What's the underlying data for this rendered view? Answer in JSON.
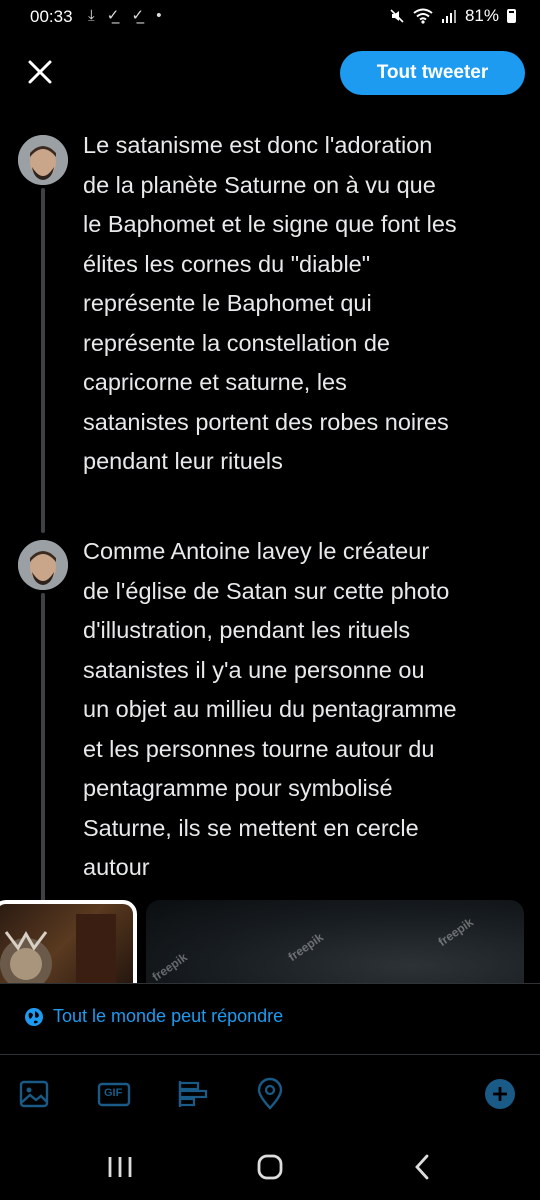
{
  "status_bar": {
    "time": "00:33",
    "left_icons": "⤓ ✓̲ ✓̲ •",
    "battery": "81%",
    "icons": [
      "download-icon",
      "check-icon",
      "check-icon",
      "dot-icon",
      "mute-icon",
      "wifi-icon",
      "signal-icon",
      "battery-icon"
    ]
  },
  "header": {
    "close_icon": "close-icon",
    "tweet_all_label": "Tout tweeter"
  },
  "thread": [
    {
      "avatar": "avatar",
      "text": "Le satanisme est donc l'adoration\nde la planète Saturne on à vu que\nle Baphomet et le signe que font les\nélites les cornes du \"diable\"\nreprésente le Baphomet qui\nreprésente la constellation de\ncapricorne et saturne, les\nsatanistes portent des robes noires\npendant leur rituels"
    },
    {
      "avatar": "avatar",
      "text": "Comme Antoine lavey le créateur\nde l'église de Satan sur cette photo\nd'illustration, pendant les rituels\nsatanistes il y'a une personne ou\nun objet au millieu du pentagramme\net les personnes tourne autour du\npentagramme pour symbolisé\nSaturne, ils se mettent en cercle\nautour"
    }
  ],
  "media": {
    "watermark": "freepik"
  },
  "reply_setting": {
    "icon": "globe-icon",
    "label": "Tout le monde peut répondre"
  },
  "toolbar": {
    "items": [
      "image-icon",
      "gif-icon",
      "poll-icon",
      "location-icon",
      "add-icon"
    ],
    "gif_label": "GIF"
  },
  "nav": {
    "items": [
      "recents-icon",
      "home-icon",
      "back-icon"
    ]
  },
  "colors": {
    "accent": "#1d9bf0",
    "background": "#000000",
    "text": "#e7e9ea",
    "thread_line": "#3e4144"
  }
}
